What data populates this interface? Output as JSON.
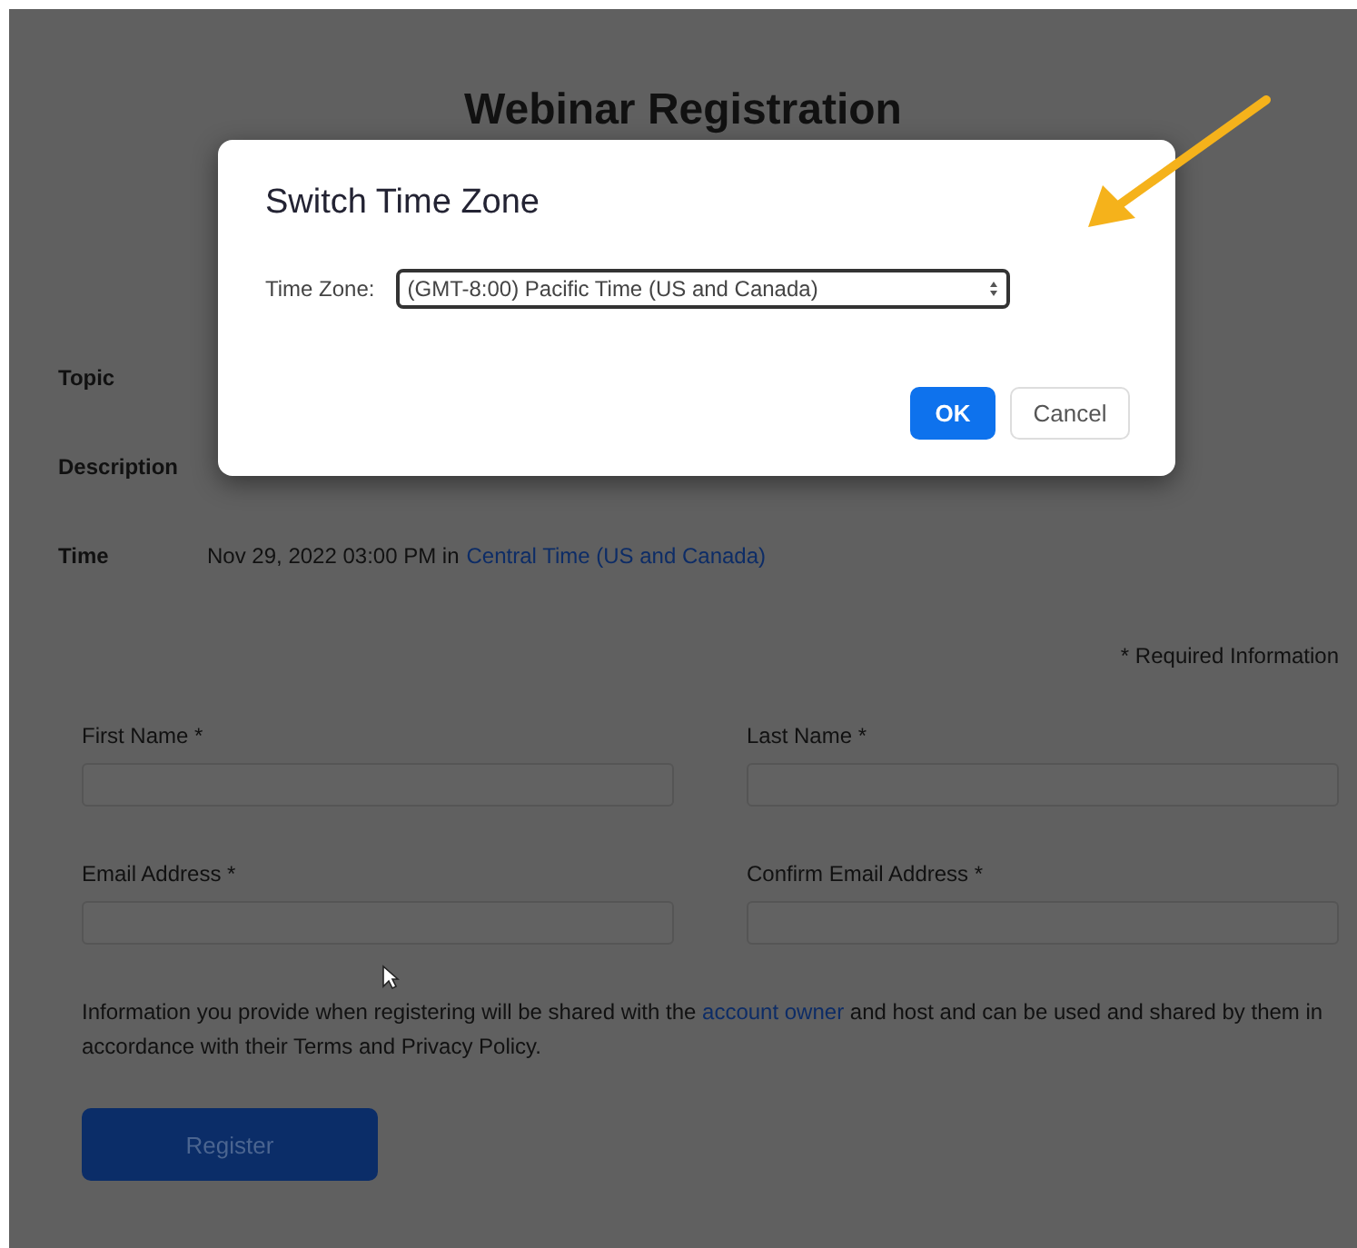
{
  "page": {
    "title": "Webinar Registration",
    "details": [
      {
        "label": "Topic"
      },
      {
        "label": "Description"
      },
      {
        "label": "Time",
        "value": "Nov 29, 2022 03:00 PM in",
        "link": "Central Time (US and Canada)"
      }
    ],
    "required_note": "* Required Information",
    "fields": [
      {
        "label": "First Name *"
      },
      {
        "label": "Last Name *"
      },
      {
        "label": "Email Address *"
      },
      {
        "label": "Confirm Email Address *"
      }
    ],
    "notice": {
      "before": "Information you provide when registering will be shared with the",
      "link": "account owner",
      "after": "and host and can be used and shared by them in accordance with their Terms and Privacy Policy."
    },
    "register_button": "Register"
  },
  "dialog": {
    "title": "Switch Time Zone",
    "field_label": "Time Zone:",
    "value": "(GMT-8:00) Pacific Time (US and Canada)",
    "buttons": [
      {
        "label": "OK",
        "kind": "primary"
      },
      {
        "label": "Cancel",
        "kind": "secondary"
      }
    ]
  }
}
